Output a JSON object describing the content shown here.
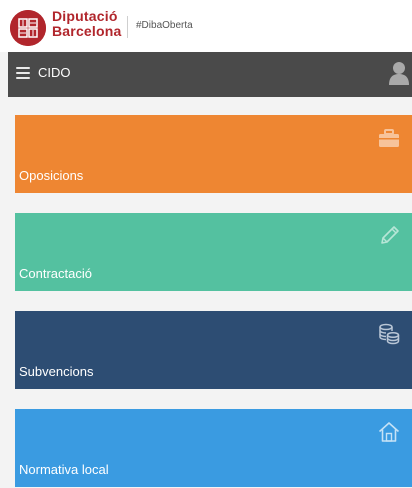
{
  "brand": {
    "line1": "Diputació",
    "line2": "Barcelona",
    "hashtag": "#DibaOberta"
  },
  "navbar": {
    "title": "CIDO"
  },
  "cards": [
    {
      "label": "Oposicions",
      "icon": "briefcase-icon",
      "color": "#ee8632"
    },
    {
      "label": "Contractació",
      "icon": "pencil-icon",
      "color": "#54c1a0"
    },
    {
      "label": "Subvencions",
      "icon": "coins-icon",
      "color": "#2d4d73"
    },
    {
      "label": "Normativa local",
      "icon": "house-icon",
      "color": "#3a9be1"
    }
  ],
  "colors": {
    "brand_red": "#b1262c",
    "navbar": "#4a4a4a",
    "background": "#f3f3f3"
  }
}
